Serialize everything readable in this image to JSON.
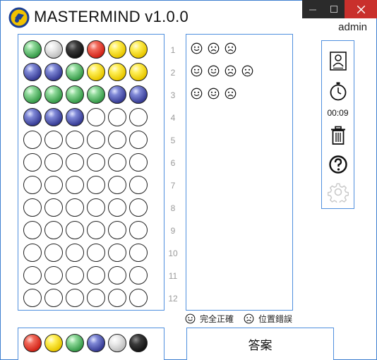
{
  "app": {
    "title": "MASTERMIND v1.0.0",
    "user": "admin"
  },
  "window_controls": [
    "minimize-button",
    "maximize-button",
    "close-button"
  ],
  "board": {
    "rows": [
      {
        "number": "1",
        "pegs": [
          "green",
          "white",
          "black",
          "red",
          "yellow",
          "yellow"
        ]
      },
      {
        "number": "2",
        "pegs": [
          "blue",
          "blue",
          "green",
          "yellow",
          "yellow",
          "yellow"
        ]
      },
      {
        "number": "3",
        "pegs": [
          "green",
          "green",
          "green",
          "green",
          "blue",
          "blue"
        ]
      },
      {
        "number": "4",
        "pegs": [
          "blue",
          "blue",
          "blue",
          "empty",
          "empty",
          "empty"
        ]
      },
      {
        "number": "5",
        "pegs": [
          "empty",
          "empty",
          "empty",
          "empty",
          "empty",
          "empty"
        ]
      },
      {
        "number": "6",
        "pegs": [
          "empty",
          "empty",
          "empty",
          "empty",
          "empty",
          "empty"
        ]
      },
      {
        "number": "7",
        "pegs": [
          "empty",
          "empty",
          "empty",
          "empty",
          "empty",
          "empty"
        ]
      },
      {
        "number": "8",
        "pegs": [
          "empty",
          "empty",
          "empty",
          "empty",
          "empty",
          "empty"
        ]
      },
      {
        "number": "9",
        "pegs": [
          "empty",
          "empty",
          "empty",
          "empty",
          "empty",
          "empty"
        ]
      },
      {
        "number": "10",
        "pegs": [
          "empty",
          "empty",
          "empty",
          "empty",
          "empty",
          "empty"
        ]
      },
      {
        "number": "11",
        "pegs": [
          "empty",
          "empty",
          "empty",
          "empty",
          "empty",
          "empty"
        ]
      },
      {
        "number": "12",
        "pegs": [
          "empty",
          "empty",
          "empty",
          "empty",
          "empty",
          "empty"
        ]
      }
    ]
  },
  "feedback": [
    [
      "happy",
      "sad",
      "sad"
    ],
    [
      "happy",
      "happy",
      "sad",
      "sad"
    ],
    [
      "happy",
      "happy",
      "sad"
    ]
  ],
  "legend": {
    "correct_label": "完全正確",
    "misplaced_label": "位置錯誤"
  },
  "sidebar": {
    "timer": "00:09",
    "icons": [
      "profile-icon",
      "stopwatch-icon",
      "trash-icon",
      "help-icon",
      "settings-icon"
    ]
  },
  "palette": [
    "red",
    "yellow",
    "green",
    "blue",
    "white",
    "black"
  ],
  "answer_label": "答案"
}
